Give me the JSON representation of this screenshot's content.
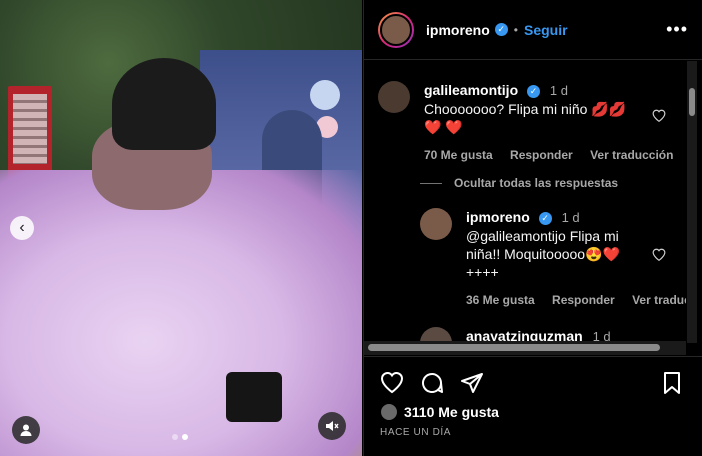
{
  "post": {
    "account": {
      "username": "ipmoreno",
      "follow_label": "Seguir",
      "separator": "•"
    },
    "carousel": {
      "slides": 2,
      "current": 2
    }
  },
  "comments": [
    {
      "username": "galileamontijo",
      "time": "1 d",
      "text": "Chooooooo? Flipa mi niño 💋💋❤️ ❤️",
      "likes": "70 Me gusta",
      "reply_label": "Responder",
      "translate_label": "Ver traducción"
    }
  ],
  "hide_replies_label": "Ocultar todas las respuestas",
  "reply": {
    "username": "ipmoreno",
    "time": "1 d",
    "text": "@galileamontijo Flipa mi niña!! Moquitooooo😍❤️ ++++",
    "likes": "36 Me gusta",
    "reply_label": "Responder",
    "translate_label": "Ver traducción"
  },
  "next_comment": {
    "username": "anayatzinguzman",
    "time": "1 d"
  },
  "footer": {
    "likes": "3110 Me gusta",
    "date": "HACE UN DÍA"
  },
  "icons": {
    "prev": "chevron-left-icon",
    "tag": "user-tag-icon",
    "mute": "muted-speaker-icon",
    "more": "more-horizontal-icon",
    "like": "heart-icon",
    "comment": "comment-icon",
    "share": "send-icon",
    "save": "bookmark-icon"
  },
  "colors": {
    "accent": "#3897f0",
    "background": "#000000",
    "secondary_text": "#a8a8a8"
  }
}
